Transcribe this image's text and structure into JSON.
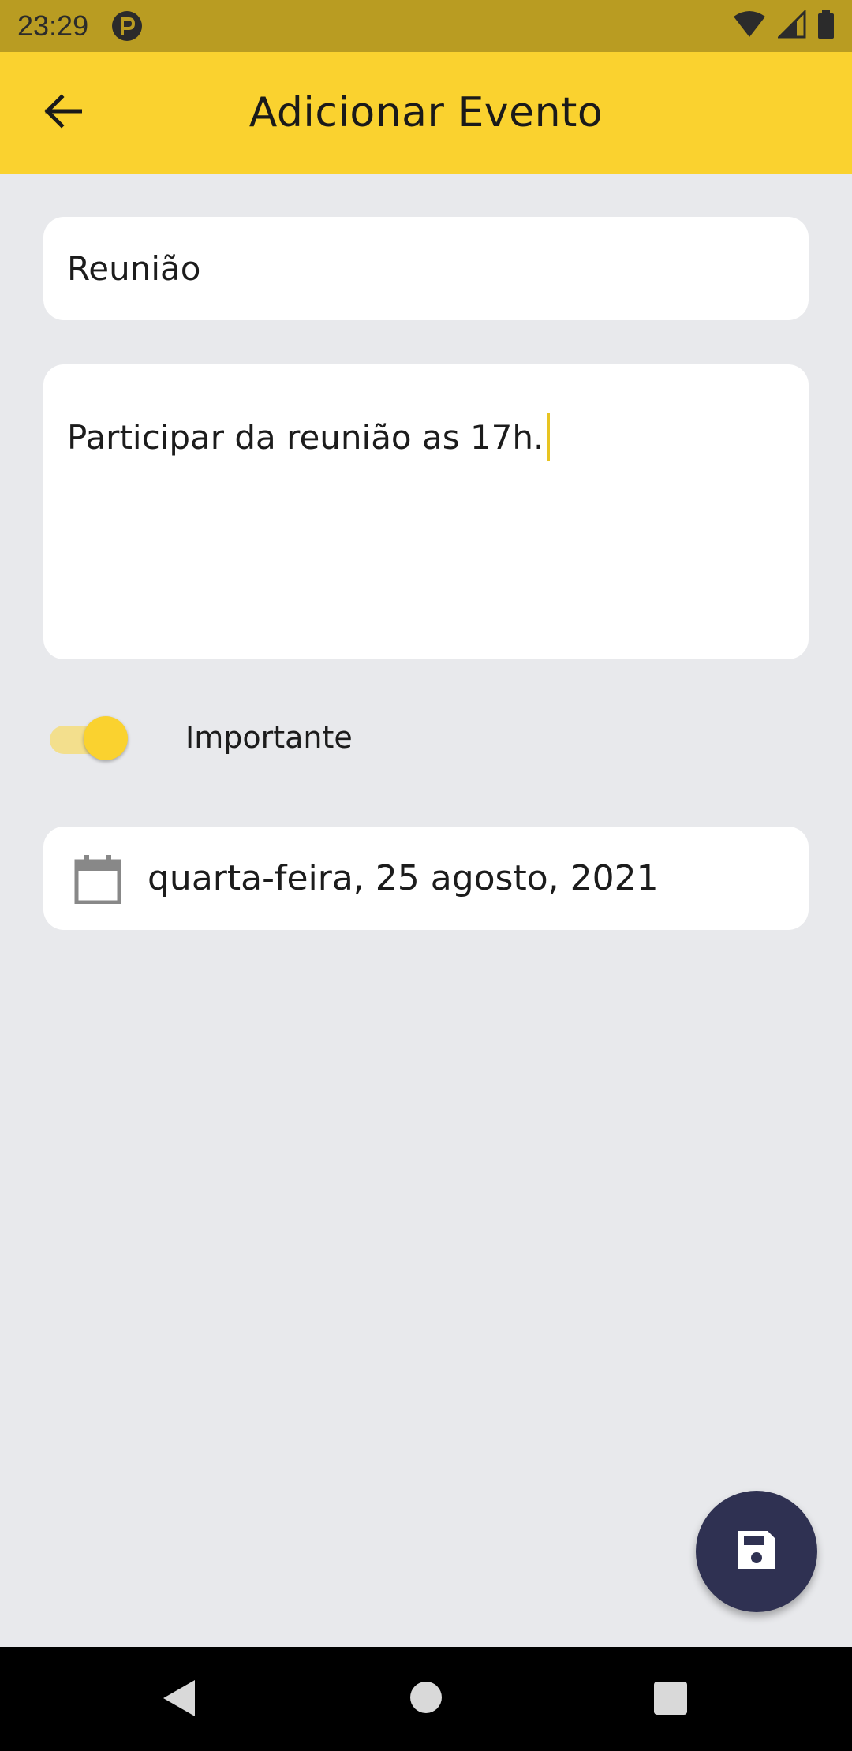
{
  "status_bar": {
    "time": "23:29",
    "icons": [
      "app-notification-icon",
      "wifi-icon",
      "cell-signal-icon",
      "battery-icon"
    ]
  },
  "app_bar": {
    "title": "Adicionar Evento",
    "back_icon": "arrow-left-icon"
  },
  "form": {
    "title_value": "Reunião",
    "description_value": "Participar da reunião as 17h.",
    "important_label": "Importante",
    "important_on": true,
    "date_value": "quarta-feira, 25 agosto, 2021",
    "date_icon": "calendar-icon"
  },
  "fab": {
    "icon": "save-icon"
  },
  "nav_bar": {
    "icons": [
      "back-triangle-icon",
      "home-circle-icon",
      "recents-square-icon"
    ]
  },
  "colors": {
    "accent": "#fad22f",
    "status_bar": "#b99c22",
    "background": "#e8e9ec",
    "fab": "#2f3152"
  }
}
